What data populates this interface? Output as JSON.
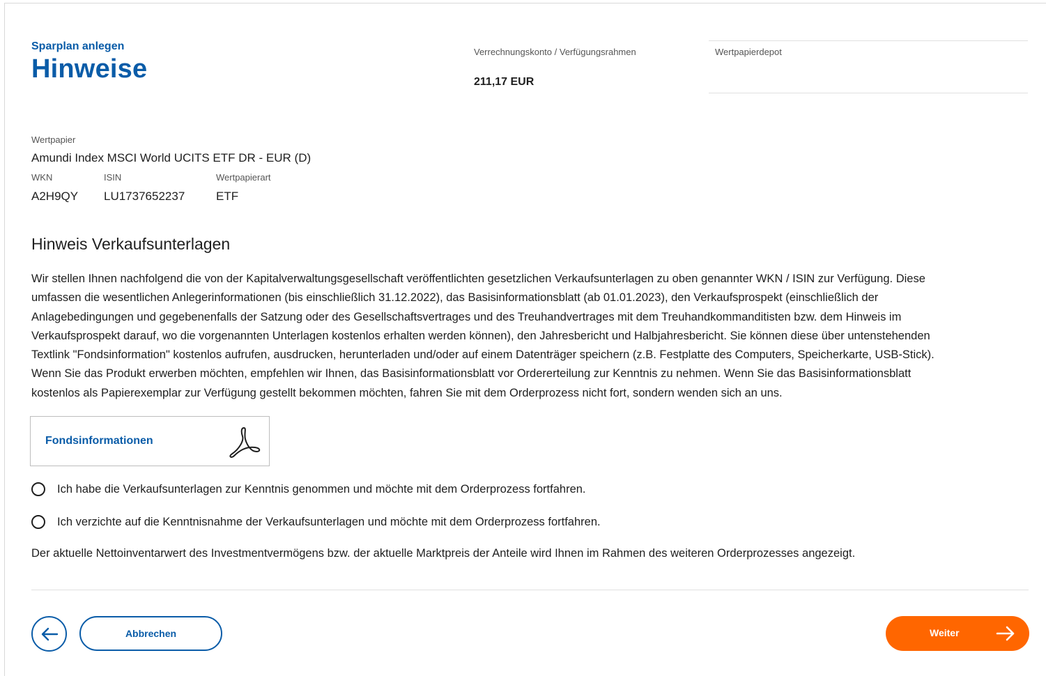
{
  "header": {
    "eyebrow": "Sparplan anlegen",
    "title": "Hinweise",
    "account_label": "Verrechnungskonto / Verfügungsrahmen",
    "account_value": "211,17 EUR",
    "depot_label": "Wertpapierdepot"
  },
  "security": {
    "label": "Wertpapier",
    "name": "Amundi Index MSCI World UCITS ETF DR - EUR (D)",
    "wkn_label": "WKN",
    "wkn": "A2H9QY",
    "isin_label": "ISIN",
    "isin": "LU1737652237",
    "type_label": "Wertpapierart",
    "type": "ETF"
  },
  "notice": {
    "title": "Hinweis Verkaufsunterlagen",
    "lines": [
      "Wir stellen Ihnen nachfolgend die von der Kapitalverwaltungsgesellschaft veröffentlichten gesetzlichen Verkaufsunterlagen zu oben genannter WKN / ISIN zur Verfügung. Diese",
      "umfassen die wesentlichen Anlegerinformationen (bis einschließlich 31.12.2022), das Basisinformationsblatt (ab 01.01.2023), den Verkaufsprospekt (einschließlich der",
      "Anlagebedingungen und gegebenenfalls der Satzung oder des Gesellschaftsvertrages und des Treuhandvertrages mit dem Treuhandkommanditisten bzw. dem Hinweis im",
      "Verkaufsprospekt darauf, wo die vorgenannten Unterlagen kostenlos erhalten werden können), den Jahresbericht und Halbjahresbericht. Sie können diese über untenstehenden",
      "Textlink \"Fondsinformation\" kostenlos aufrufen, ausdrucken, herunterladen und/oder auf einem Datenträger speichern (z.B. Festplatte des Computers, Speicherkarte, USB-Stick).",
      "Wenn Sie das Produkt erwerben möchten, empfehlen wir Ihnen, das Basisinformationsblatt vor Ordererteilung zur Kenntnis zu nehmen. Wenn Sie das Basisinformationsblatt",
      "kostenlos als Papierexemplar zur Verfügung gestellt bekommen möchten, fahren Sie mit dem Orderprozess nicht fort, sondern wenden sich an uns."
    ],
    "pdf_link_label": "Fondsinformationen",
    "options": [
      "Ich habe die Verkaufsunterlagen zur Kenntnis genommen und möchte mit dem Orderprozess fortfahren.",
      "Ich verzichte auf die Kenntnisnahme der Verkaufsunterlagen und möchte mit dem Orderprozess fortfahren."
    ],
    "footer_note": "Der aktuelle Nettoinventarwert des Investmentvermögens bzw. der aktuelle Marktpreis der Anteile wird Ihnen im Rahmen des weiteren Orderprozesses angezeigt."
  },
  "actions": {
    "cancel_label": "Abbrechen",
    "next_label": "Weiter",
    "back_icon": "arrow-left-icon",
    "next_icon": "arrow-right-icon"
  },
  "colors": {
    "brand_blue": "#0a5ca8",
    "accent_orange": "#ff6600"
  }
}
